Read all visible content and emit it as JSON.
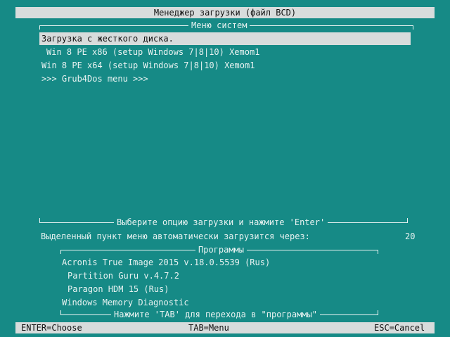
{
  "title": "Менеджер загрузки (файл BCD)",
  "system_menu": {
    "header": "Меню систем",
    "items": [
      "Загрузка с жесткого диска.",
      "Win 8 PE x86  (setup Windows 7|8|10)  Xemom1",
      "Win 8 PE x64  (setup Windows 7|8|10)  Xemom1",
      ">>> Grub4Dos menu >>>"
    ],
    "selected_index": 0
  },
  "prompt": "Выберите опцию загрузки и нажмите 'Enter'",
  "autoboot": {
    "text": "Выделенный пункт меню автоматически загрузится через:",
    "seconds": "20"
  },
  "programs": {
    "header": "Программы",
    "items": [
      "Acronis True Image 2015 v.18.0.5539 (Rus)",
      "Partition Guru v.4.7.2",
      "Paragon HDM 15 (Rus)",
      "Windows Memory Diagnostic"
    ],
    "footer": "Нажмите 'TAB' для перехода в \"программы\""
  },
  "keys": {
    "enter": "ENTER=Choose",
    "tab": "TAB=Menu",
    "esc": "ESC=Cancel"
  },
  "colors": {
    "background": "#168a86",
    "bar": "#d8dcdc",
    "text": "#e9f3f2"
  }
}
